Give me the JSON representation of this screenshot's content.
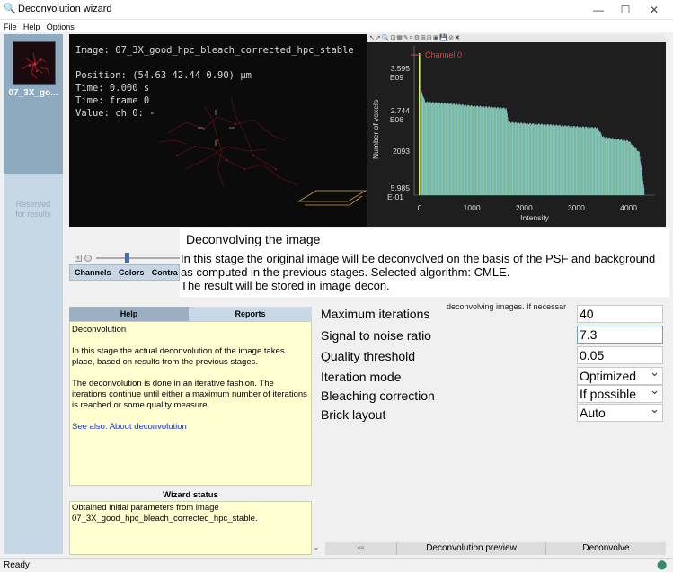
{
  "window": {
    "title": "Deconvolution wizard",
    "minimize": "—",
    "maximize": "☐",
    "close": "✕"
  },
  "menu": [
    "File",
    "Help",
    "Options"
  ],
  "sidebar": {
    "thumb_label": "07_3X_go...",
    "reserved_line1": "Reserved",
    "reserved_line2": "for results"
  },
  "viewer": {
    "info": "Image: 07_3X_good_hpc_bleach_corrected_hpc_stable\n\nPosition: (54.63 42.44 0.90) µm\nTime: 0.000 s\nTime: frame 0\nValue: ch 0: -"
  },
  "histogram": {
    "toolbar": "↖↗🔍⊡▦✎⌗⚙⊞⊟▣💾⊘✖",
    "legend": "Channel 0",
    "ylabel": "Number of voxels",
    "xlabel": "Intensity",
    "yticks": [
      [
        "3.595",
        "E09"
      ],
      [
        "2.744",
        "E06"
      ],
      [
        "2093",
        ""
      ],
      [
        "5.985",
        "E-01"
      ]
    ],
    "xticks": [
      "0",
      "1000",
      "2000",
      "3000",
      "4000"
    ]
  },
  "chart_data": {
    "type": "bar",
    "title": "",
    "xlabel": "Intensity",
    "ylabel": "Number of voxels",
    "legend": "Channel 0",
    "log_scale": true,
    "xlim": [
      0,
      4300
    ],
    "ytick_labels": [
      "3.595E09",
      "2.744E06",
      "2093",
      "5.985E-01"
    ],
    "x": [
      0,
      20,
      100,
      500,
      1000,
      1500,
      1650,
      1700,
      2000,
      2500,
      3000,
      3400,
      3500,
      4000,
      4200,
      4300
    ],
    "y": [
      3595000000,
      10000000,
      1500000,
      1200000,
      800000,
      600000,
      550000,
      60000,
      50000,
      40000,
      30000,
      25000,
      6000,
      3000,
      500,
      1
    ]
  },
  "overlay": {
    "title": "Deconvolving the image",
    "line1": "In this stage the original image will be deconvolved on the basis of the PSF and background",
    "line2": "as computed in the previous stages. Selected algorithm: CMLE.",
    "line3": "The result will be stored in image decon."
  },
  "viewtabs": [
    "Channels",
    "Colors",
    "Contra"
  ],
  "help": {
    "tab_help": "Help",
    "tab_reports": "Reports",
    "heading": "Deconvolution",
    "p1": "In this stage the actual deconvolution of the image takes place, based on results from the previous stages.",
    "p2": "The deconvolution is done in an iterative fashion. The iterations continue until either a maximum number of iterations is reached or some quality measure.",
    "see_also": "See also: About deconvolution"
  },
  "wizard_status": {
    "heading": "Wizard status",
    "line1": "Obtained initial parameters from image",
    "line2": "07_3X_good_hpc_bleach_corrected_hpc_stable."
  },
  "cutoff_text": "deconvolving images. If necessar",
  "params": [
    {
      "label": "Maximum iterations",
      "value": "40"
    },
    {
      "label": "Signal to noise ratio",
      "value": "7.3"
    },
    {
      "label": "Quality threshold",
      "value": "0.05"
    },
    {
      "label": "Iteration mode",
      "value": "Optimized"
    },
    {
      "label": "Bleaching correction",
      "value": "If possible"
    },
    {
      "label": "Brick layout",
      "value": "Auto"
    }
  ],
  "buttons": {
    "back": "⇦",
    "preview": "Deconvolution preview",
    "deconvolve": "Deconvolve"
  },
  "status": {
    "text": "Ready"
  },
  "colors": {
    "histogram_bg": "#1e1e1e",
    "legend": "#d94545",
    "panel_blue": "#c6d7e6",
    "help_bg": "#ffffcf"
  }
}
